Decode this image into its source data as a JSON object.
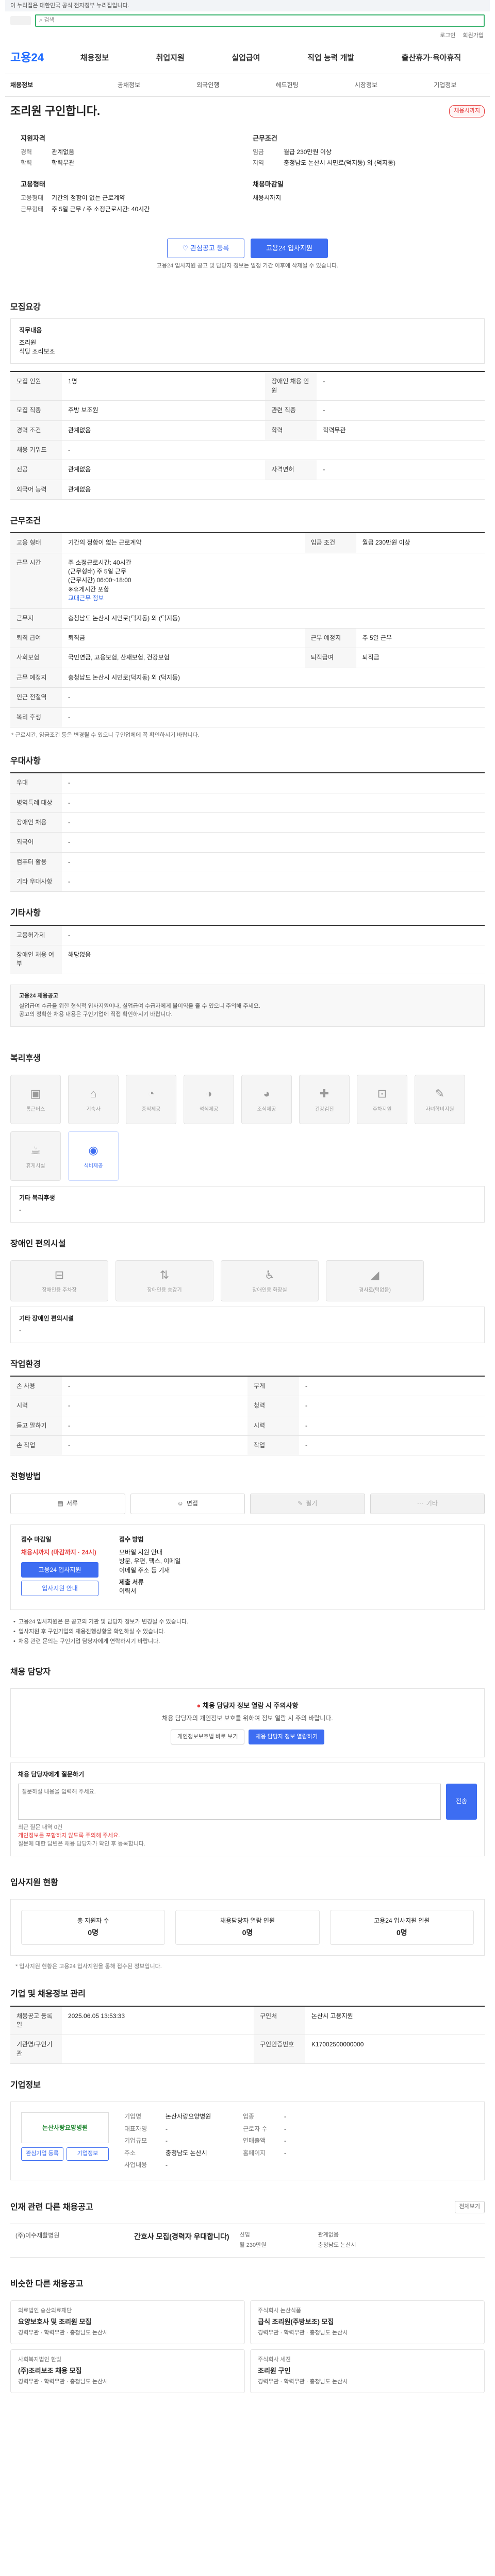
{
  "gov_bar": "이 누리집은 대한민국 공식 전자정부 누리집입니다.",
  "search": {
    "placeholder": "검색"
  },
  "util": [
    "로그인",
    "회원가입"
  ],
  "brand": "고용24",
  "gnb": [
    "채용정보",
    "취업지원",
    "실업급여",
    "직업 능력 개발",
    "출산휴가·육아휴직"
  ],
  "subnav": [
    "채용정보",
    "공채정보",
    "외국인행",
    "헤드헌팅",
    "시장정보",
    "기업정보"
  ],
  "title": "조리원 구인합니다.",
  "deadline_badge": "채용시까지",
  "summary": {
    "qual_head": "지원자격",
    "career_k": "경력",
    "career_v": "관계없음",
    "edu_k": "학력",
    "edu_v": "학력무관",
    "emp_head": "고용형태",
    "emp_k": "고용형태",
    "emp_v": "기간의 정함이 없는 근로계약",
    "type_k": "근무형태",
    "type_v": "주 5일 근무 / 주 소정근로시간: 40시간",
    "cond_head": "근무조건",
    "wage_k": "임금",
    "wage_v": "월급 230만원 이상",
    "loc_k": "지역",
    "loc_v": "충청남도 논산시 시민로(덕지동) 외 (덕지동)",
    "deadline_head": "채용마감일",
    "deadline_v": "채용시까지"
  },
  "buttons": {
    "interest": "관심공고 등록",
    "apply": "고용24 입사지원"
  },
  "notice": "고용24 입사지원 공고 및 담당자 정보는 일정 기간 이후에 삭제될 수 있습니다.",
  "s_recruit": "모집요강",
  "recruit": {
    "job_k": "직무내용",
    "job_v": "조리원",
    "job_desc": "식당 조리보조",
    "rows": [
      [
        "모집 인원",
        "1명",
        "장애인 채용 인원",
        "-"
      ],
      [
        "모집 직종",
        "주방 보조원",
        "관련 직종",
        "-"
      ],
      [
        "경력 조건",
        "관계없음",
        "학력",
        "학력무관"
      ],
      [
        "채용 키워드",
        "-",
        "",
        ""
      ],
      [
        "전공",
        "관계없음",
        "자격면허",
        "-"
      ],
      [
        "외국어 능력",
        "관계없음",
        "",
        ""
      ]
    ]
  },
  "s_cond": "근무조건",
  "cond": {
    "emp_k": "고용 형태",
    "emp_v": "기간의 정함이 없는 근로계약",
    "wage_k": "임금 조건",
    "wage_v": "월급 230만원 이상",
    "extra": "주 소정근로시간: 40시간",
    "time_k": "근무 시간",
    "time_lines": [
      "(근무형태) 주 5일 근무",
      "(근무시간) 06:00~18:00",
      "※휴게시간 포함",
      "교대근무 정보"
    ],
    "loc_k": "근무지",
    "loc_v": "충청남도 논산시 시민로(덕지동) 외 (덕지동)",
    "rows": [
      [
        "퇴직 급여",
        "퇴직금",
        "근무 예정지",
        "주 5일 근무"
      ],
      [
        "사회보험",
        "국민연금, 고용보험, 산재보험, 건강보험",
        "퇴직급여",
        "퇴직금"
      ],
      [
        "근무 예정지",
        "충청남도 논산시 시민로(덕지동) 외 (덕지동)",
        "",
        ""
      ],
      [
        "인근 전철역",
        "-",
        "",
        ""
      ],
      [
        "복리 후생",
        "-",
        "",
        ""
      ]
    ],
    "footnote": "* 근로시간, 임금조건 등은 변경될 수 있으니 구인업체에 꼭 확인하시기 바랍니다."
  },
  "s_welfare": "우대사항",
  "welfare_rows": [
    [
      "우대",
      "-"
    ],
    [
      "병역특례 대상",
      "-"
    ],
    [
      "장애인 채용",
      "-"
    ],
    [
      "외국어",
      "-"
    ],
    [
      "컴퓨터 활용",
      "-"
    ],
    [
      "기타 우대사항",
      "-"
    ]
  ],
  "s_etc": "기타사항",
  "etc_rows": [
    [
      "고용허가제",
      "-"
    ],
    [
      "장애인 채용 여부",
      "해당없음"
    ]
  ],
  "info": {
    "title": "고용24 채용공고",
    "line1": "실업급여 수급을 위한 형식적 입사지원이나, 실업급여 수급자에게 불이익을 줄 수 있으니 주의해 주세요.",
    "line2": "공고의 정확한 채용 내용은 구인기업에 직접 확인하시기 바랍니다."
  },
  "s_benefit": "복리후생",
  "benefits": [
    {
      "label": "통근버스",
      "on": false
    },
    {
      "label": "기숙사",
      "on": false
    },
    {
      "label": "중식제공",
      "on": false
    },
    {
      "label": "석식제공",
      "on": false
    },
    {
      "label": "조식제공",
      "on": false
    },
    {
      "label": "건강검진",
      "on": false
    },
    {
      "label": "주차지원",
      "on": false
    },
    {
      "label": "자녀학비지원",
      "on": false
    },
    {
      "label": "휴게시설",
      "on": false
    },
    {
      "label": "식비제공",
      "on": true
    }
  ],
  "benefit_etc_k": "기타 복리후생",
  "benefit_etc_v": "-",
  "s_access": "장애인 편의시설",
  "access": [
    "장애인용 주차장",
    "장애인용 승강기",
    "장애인용 화장실",
    "경사로(턱없음)"
  ],
  "access_etc_k": "기타 장애인 편의시설",
  "access_etc_v": "-",
  "s_env": "작업환경",
  "env_rows": [
    [
      "손 사용",
      "-",
      "무게",
      "-"
    ],
    [
      "시력",
      "-",
      "청력",
      "-"
    ],
    [
      "듣고 말하기",
      "-",
      "시력",
      "-"
    ],
    [
      "손 작업",
      "-",
      "작업",
      "-"
    ]
  ],
  "s_method": "전형방법",
  "methods": [
    {
      "label": "서류",
      "dim": false
    },
    {
      "label": "면접",
      "dim": false
    },
    {
      "label": "필기",
      "dim": true
    },
    {
      "label": "기타",
      "dim": true
    }
  ],
  "apply": {
    "left_title": "접수 마감일",
    "left_sub": "채용시까지 (마감까지 · 24시)",
    "btn1": "고용24 입사지원",
    "btn2": "입사지원 안내",
    "right_title": "접수 방법",
    "right_lines": [
      "모바일 지원 안내",
      "방문, 우편, 팩스, 이메일",
      "이메일 주소 등 기재",
      "제출 서류",
      "이력서"
    ]
  },
  "apply_bullets": [
    "고용24 입사지원은 본 공고의 기관 및 담당자 정보가 변경될 수 있습니다.",
    "입사지원 후 구인기업의 채용진행상황을 확인하실 수 있습니다.",
    "채용 관련 문의는 구인기업 담당자에게 연락하시기 바랍니다."
  ],
  "s_manager": "채용 담당자",
  "warn": {
    "title": "채용 담당자 정보 열람 시 주의사항",
    "body": "채용 담당자의 개인정보 보호를 위하여 정보 열람 시 주의 바랍니다.",
    "btn1": "개인정보보호법 바로 보기",
    "btn2": "채용 담당자 정보 열람하기"
  },
  "ask": {
    "title": "채용 담당자에게 질문하기",
    "placeholder": "질문하실 내용을 입력해 주세요.",
    "send": "전송",
    "note1": "최근 질문 내역 0건",
    "note2": "개인정보를 포함하지 않도록 주의해 주세요.",
    "note3": "질문에 대한 답변은 채용 담당자가 확인 후 등록합니다."
  },
  "s_status": "입사지원 현황",
  "status": [
    {
      "label": "총 지원자 수",
      "value": "0명"
    },
    {
      "label": "채용담당자 열람 인원",
      "value": "0명"
    },
    {
      "label": "고용24 입사지원 인원",
      "value": "0명"
    }
  ],
  "status_note": "* 입사지원 현황은 고용24 입사지원을 통해 접수된 정보입니다.",
  "s_management": "기업 및 채용정보 관리",
  "management": {
    "reg_k": "채용공고 등록일",
    "reg_v": "2025.06.05 13:53:33",
    "hire_k": "구인처",
    "hire_v": "논산시 고용지원",
    "corp_k": "기관명/구인기관",
    "corp_v": "",
    "num_k": "구인인증번호",
    "num_v": "K17002500000000"
  },
  "s_company": "기업정보",
  "company": {
    "logo": "논산사랑요양병원",
    "btn1": "관심기업 등록",
    "btn2": "기업정보",
    "kv": [
      [
        "기업명",
        "논산사랑요양병원",
        "업종",
        "-"
      ],
      [
        "대표자명",
        "-",
        "근로자 수",
        "-"
      ],
      [
        "기업규모",
        "-",
        "연매출액",
        "-"
      ],
      [
        "주소",
        "충청남도 논산시",
        "홈페이지",
        "-"
      ],
      [
        "사업내용",
        "-",
        "",
        ""
      ]
    ]
  },
  "s_related": "인재 관련 다른 채용공고",
  "related_more": "전체보기",
  "related": [
    {
      "company": "(주)이수재활병원",
      "title": "간호사 모집(경력자 우대합니다)",
      "meta": [
        "신입",
        "관계없음",
        "월 230만원",
        "충청남도 논산시"
      ]
    }
  ],
  "s_similar": "비슷한 다른 채용공고",
  "similar": [
    {
      "company": "의료법인 송산의료재단",
      "title": "요양보호사 및 조리원 모집",
      "meta": "경력무관 · 학력무관 · 충청남도 논산시"
    },
    {
      "company": "주식회사 논산식품",
      "title": "급식 조리원(주방보조) 모집",
      "meta": "경력무관 · 학력무관 · 충청남도 논산시"
    },
    {
      "company": "사회복지법인 한빛",
      "title": "(주)조리보조 채용 모집",
      "meta": "경력무관 · 학력무관 · 충청남도 논산시"
    },
    {
      "company": "주식회사 세진",
      "title": "조리원 구인",
      "meta": "경력무관 · 학력무관 · 충청남도 논산시"
    }
  ]
}
